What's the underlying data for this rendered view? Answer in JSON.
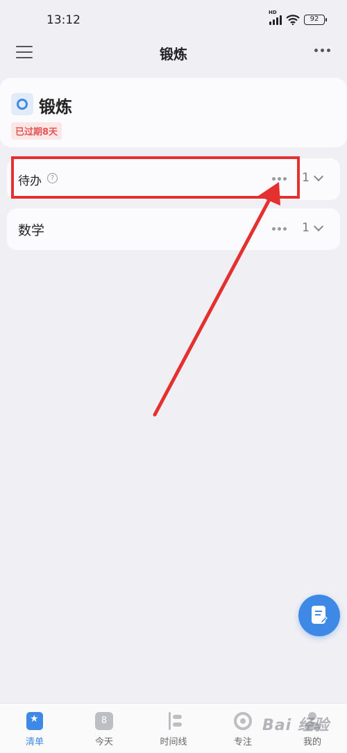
{
  "status_bar": {
    "time": "13:12",
    "network_label": "HD",
    "battery": "92"
  },
  "header": {
    "title": "锻炼",
    "menu_icon": "hamburger-icon",
    "more_icon": "more-icon"
  },
  "list": {
    "name": "锻炼",
    "badge": "已过期8天",
    "icon_color": "#3e89e6"
  },
  "sections": [
    {
      "label": "待办",
      "has_help": true,
      "count": "1"
    },
    {
      "label": "数学",
      "has_help": false,
      "count": "1"
    }
  ],
  "annotation": {
    "color": "#e53030"
  },
  "fab": {
    "icon": "note-edit-icon",
    "color": "#3e89e6"
  },
  "bottom_nav": [
    {
      "label": "清单",
      "icon": "list-star-icon",
      "active": true
    },
    {
      "label": "今天",
      "icon": "calendar-icon",
      "icon_text": "8"
    },
    {
      "label": "时间线",
      "icon": "timeline-icon"
    },
    {
      "label": "专注",
      "icon": "focus-icon"
    },
    {
      "label": "我的",
      "icon": "profile-icon"
    }
  ],
  "watermark": "Bai 经验"
}
